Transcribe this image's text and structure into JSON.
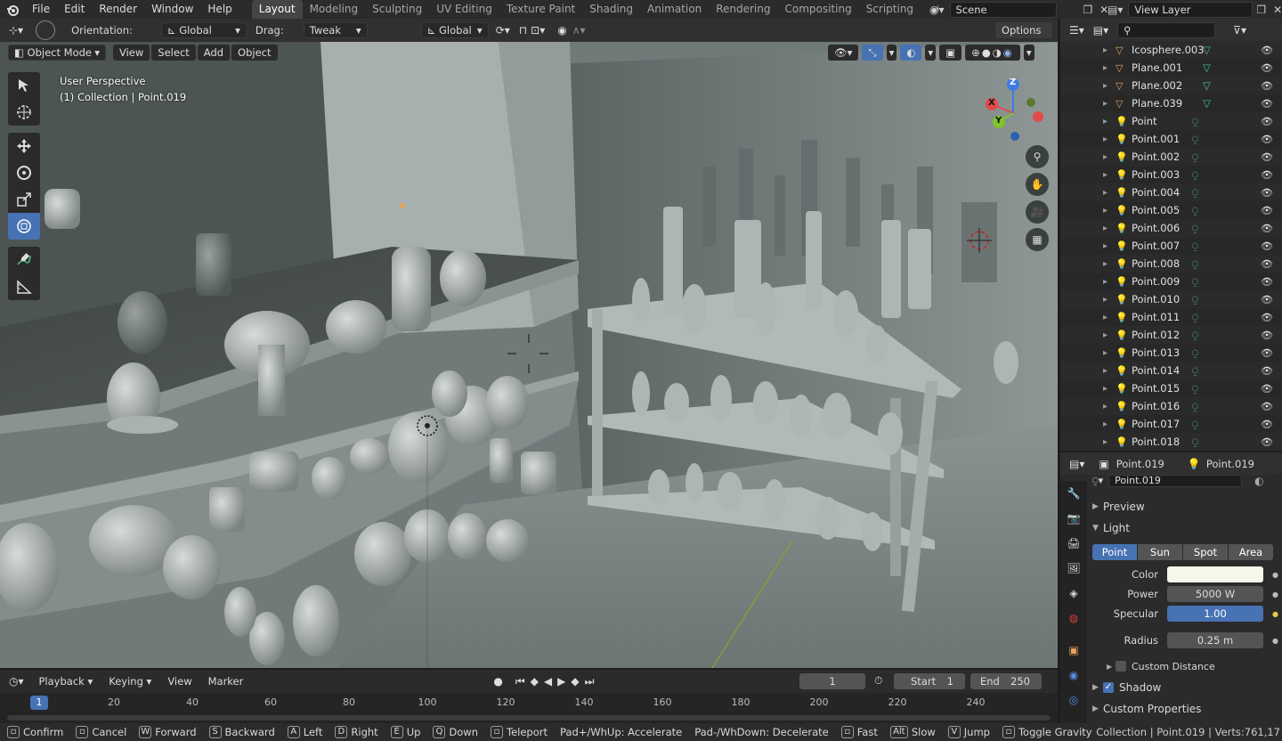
{
  "topbar": {
    "menus": [
      "File",
      "Edit",
      "Render",
      "Window",
      "Help"
    ],
    "workspaces": [
      "Layout",
      "Modeling",
      "Sculpting",
      "UV Editing",
      "Texture Paint",
      "Shading",
      "Animation",
      "Rendering",
      "Compositing",
      "Scripting"
    ],
    "active_workspace": "Layout",
    "add_workspace": "+",
    "scene": "Scene",
    "view_layer": "View Layer"
  },
  "toolhdr": {
    "orientation_label": "Orientation:",
    "orientation_value": "Global",
    "drag_label": "Drag:",
    "drag_value": "Tweak",
    "transform_orientation": "Global",
    "options": "Options"
  },
  "vphdr": {
    "mode": "Object Mode",
    "menus": [
      "View",
      "Select",
      "Add",
      "Object"
    ]
  },
  "viewport": {
    "perspective": "User Perspective",
    "collection": "(1) Collection | Point.019",
    "gizmo": {
      "x": "X",
      "y": "Y",
      "z": "Z"
    }
  },
  "outliner": {
    "search_placeholder": "",
    "rows": [
      {
        "name": "Icosphere.003",
        "kind": "mesh"
      },
      {
        "name": "Plane.001",
        "kind": "mesh"
      },
      {
        "name": "Plane.002",
        "kind": "mesh"
      },
      {
        "name": "Plane.039",
        "kind": "mesh"
      },
      {
        "name": "Point",
        "kind": "light"
      },
      {
        "name": "Point.001",
        "kind": "light"
      },
      {
        "name": "Point.002",
        "kind": "light"
      },
      {
        "name": "Point.003",
        "kind": "light"
      },
      {
        "name": "Point.004",
        "kind": "light"
      },
      {
        "name": "Point.005",
        "kind": "light"
      },
      {
        "name": "Point.006",
        "kind": "light"
      },
      {
        "name": "Point.007",
        "kind": "light"
      },
      {
        "name": "Point.008",
        "kind": "light"
      },
      {
        "name": "Point.009",
        "kind": "light"
      },
      {
        "name": "Point.010",
        "kind": "light"
      },
      {
        "name": "Point.011",
        "kind": "light"
      },
      {
        "name": "Point.012",
        "kind": "light"
      },
      {
        "name": "Point.013",
        "kind": "light"
      },
      {
        "name": "Point.014",
        "kind": "light"
      },
      {
        "name": "Point.015",
        "kind": "light"
      },
      {
        "name": "Point.016",
        "kind": "light"
      },
      {
        "name": "Point.017",
        "kind": "light"
      },
      {
        "name": "Point.018",
        "kind": "light"
      }
    ]
  },
  "props": {
    "object_name": "Point.019",
    "data_name": "Point.019",
    "datablock": "Point.019",
    "sections": {
      "preview": "Preview",
      "light": "Light",
      "custom_distance": "Custom Distance",
      "shadow": "Shadow",
      "custom_properties": "Custom Properties"
    },
    "light_types": [
      "Point",
      "Sun",
      "Spot",
      "Area"
    ],
    "active_light_type": "Point",
    "labels": {
      "color": "Color",
      "power": "Power",
      "specular": "Specular",
      "radius": "Radius"
    },
    "values": {
      "power": "5000 W",
      "specular": "1.00",
      "radius": "0.25 m"
    },
    "color_swatch": "#f4f8ea",
    "shadow_checked": true,
    "custom_distance_checked": false
  },
  "timeline": {
    "menus": [
      "Playback",
      "Keying",
      "View",
      "Marker"
    ],
    "current_frame": "1",
    "start_label": "Start",
    "start": "1",
    "end_label": "End",
    "end": "250",
    "ruler": [
      "1",
      "20",
      "40",
      "60",
      "80",
      "100",
      "120",
      "140",
      "160",
      "180",
      "200",
      "220",
      "240"
    ]
  },
  "statusbar": {
    "hints": [
      {
        "key": "",
        "label": "Confirm"
      },
      {
        "key": "",
        "label": "Cancel"
      },
      {
        "key": "W",
        "label": "Forward"
      },
      {
        "key": "S",
        "label": "Backward"
      },
      {
        "key": "A",
        "label": "Left"
      },
      {
        "key": "D",
        "label": "Right"
      },
      {
        "key": "E",
        "label": "Up"
      },
      {
        "key": "Q",
        "label": "Down"
      },
      {
        "key": "",
        "label": "Teleport"
      },
      {
        "key": "",
        "label": "Pad+/WhUp: Accelerate"
      },
      {
        "key": "",
        "label": "Pad-/WhDown: Decelerate"
      },
      {
        "key": "",
        "label": "Fast"
      },
      {
        "key": "Alt",
        "label": "Slow"
      },
      {
        "key": "V",
        "label": "Jump"
      },
      {
        "key": "",
        "label": "Toggle Gravity"
      }
    ],
    "right": "Collection | Point.019 | Verts:761,17"
  },
  "colors": {
    "accent": "#4772b3",
    "light_icon": "#e8a35a",
    "mesh_icon": "#e8a35a",
    "data_icon": "#4cc087"
  }
}
